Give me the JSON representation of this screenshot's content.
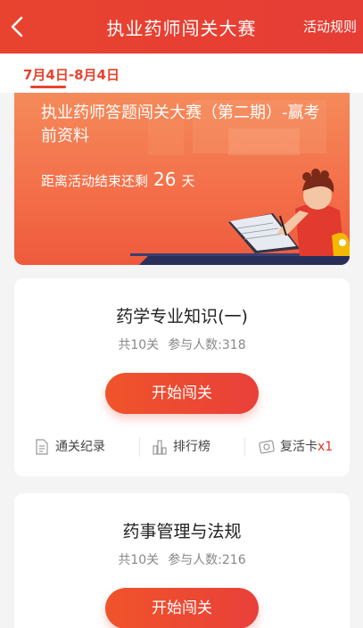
{
  "header": {
    "title": "执业药师闯关大赛",
    "rules_label": "活动规则"
  },
  "tabs": [
    {
      "label": "7月4日-8月4日",
      "active": true
    }
  ],
  "banner": {
    "title": "执业药师答题闯关大赛（第二期）-赢考前资料",
    "countdown_prefix": "距离活动结束还剩",
    "countdown_days": "26",
    "countdown_suffix": "天"
  },
  "cards": [
    {
      "title": "药学专业知识(一)",
      "levels": "共10关",
      "participants": "参与人数:318",
      "start_label": "开始闯关",
      "actions": {
        "records": "通关纪录",
        "ranking": "排行榜",
        "revive": "复活卡",
        "revive_count": "x1"
      }
    },
    {
      "title": "药事管理与法规",
      "levels": "共10关",
      "participants": "参与人数:216",
      "start_label": "开始闯关"
    }
  ],
  "colors": {
    "brand_red": "#e8432f",
    "banner_orange": "#f4704a"
  },
  "icons": {
    "back": "chevron-left-icon",
    "records": "document-icon",
    "ranking": "bar-chart-icon",
    "revive": "card-icon"
  }
}
